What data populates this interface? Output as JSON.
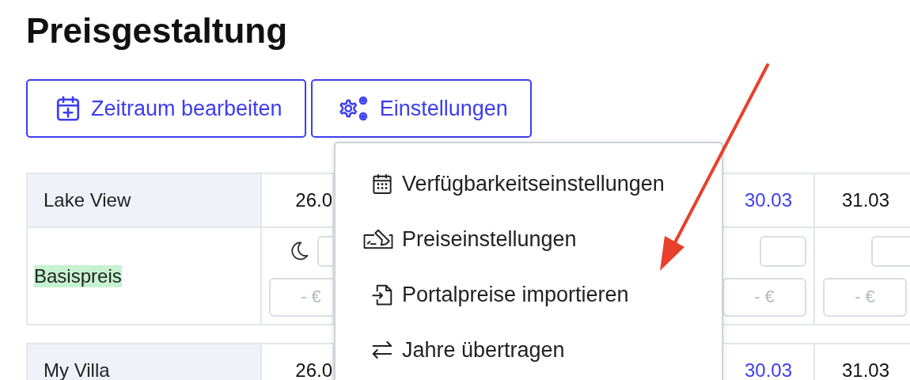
{
  "title": "Preisgestaltung",
  "toolbar": [
    {
      "kind": "calendar",
      "label": "Zeitraum bearbeiten"
    },
    {
      "kind": "settings",
      "label": "Einstellungen"
    }
  ],
  "settings_menu": {
    "items": [
      {
        "label": "Verfügbarkeitseinstellungen"
      },
      {
        "label": "Preiseinstellungen"
      },
      {
        "label": "Portalpreise importieren"
      },
      {
        "label": "Jahre übertragen"
      }
    ]
  },
  "properties": [
    {
      "name": "Lake View",
      "dates": [
        {
          "text": "26.0",
          "highlighted": false
        },
        {
          "text": "30.03",
          "highlighted": true
        },
        {
          "text": "31.03",
          "highlighted": false
        }
      ],
      "rate_rows": [
        {
          "label": "Basispreis",
          "cells": [
            {
              "moon": true,
              "placeholder": "- €"
            },
            {
              "moon": false,
              "placeholder": "- €"
            },
            {
              "moon": false,
              "placeholder": "- €"
            }
          ]
        }
      ]
    },
    {
      "name": "My Villa",
      "dates": [
        {
          "text": "26.0",
          "highlighted": false
        },
        {
          "text": "30.03",
          "highlighted": true
        },
        {
          "text": "31.03",
          "highlighted": false
        }
      ]
    }
  ],
  "annotation": {
    "kind": "arrow"
  }
}
